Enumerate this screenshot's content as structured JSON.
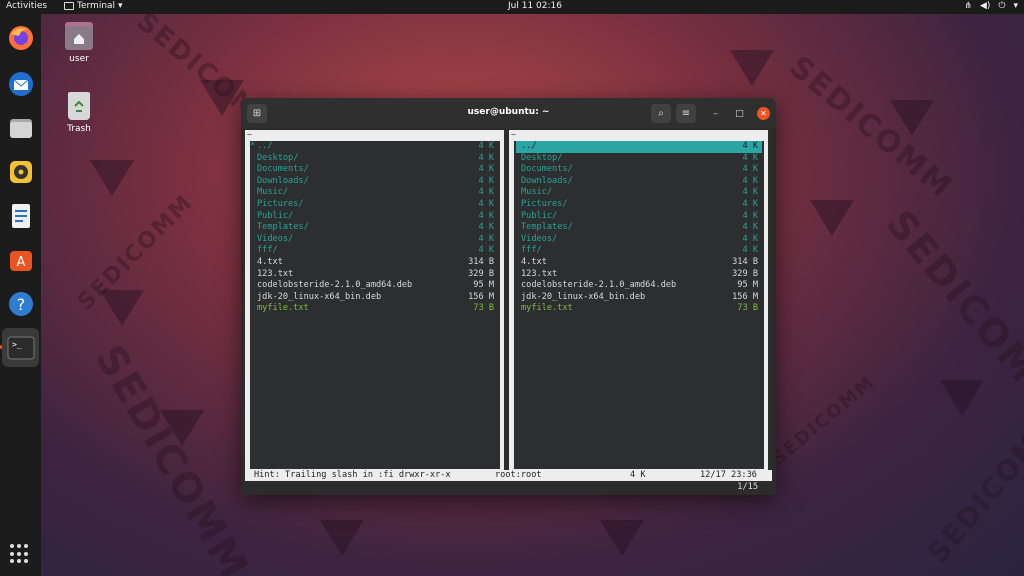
{
  "topbar": {
    "activities": "Activities",
    "app_name": "Terminal",
    "clock": "Jul 11  02:16"
  },
  "wallpaper": {
    "brand": "SEDICOMM"
  },
  "desktop": {
    "icons": [
      {
        "label": "user",
        "icon": "home-folder-icon"
      },
      {
        "label": "Trash",
        "icon": "trash-icon"
      }
    ]
  },
  "dock": {
    "items": [
      "firefox-icon",
      "thunderbird-icon",
      "files-icon",
      "rhythmbox-icon",
      "writer-icon",
      "software-icon",
      "help-icon",
      "terminal-icon"
    ],
    "show_apps": "show-applications-icon"
  },
  "window": {
    "title": "user@ubuntu: ~",
    "accent_close": "#e95420"
  },
  "left_panel": {
    "path": "~",
    "cursor_mark": "*",
    "entries": [
      {
        "name": "../",
        "size": "4 K",
        "kind": "dir"
      },
      {
        "name": "Desktop/",
        "size": "4 K",
        "kind": "dir"
      },
      {
        "name": "Documents/",
        "size": "4 K",
        "kind": "dir"
      },
      {
        "name": "Downloads/",
        "size": "4 K",
        "kind": "dir"
      },
      {
        "name": "Music/",
        "size": "4 K",
        "kind": "dir"
      },
      {
        "name": "Pictures/",
        "size": "4 K",
        "kind": "dir"
      },
      {
        "name": "Public/",
        "size": "4 K",
        "kind": "dir"
      },
      {
        "name": "Templates/",
        "size": "4 K",
        "kind": "dir"
      },
      {
        "name": "Videos/",
        "size": "4 K",
        "kind": "dir"
      },
      {
        "name": "fff/",
        "size": "4 K",
        "kind": "dir"
      },
      {
        "name": "4.txt",
        "size": "314 B",
        "kind": "file"
      },
      {
        "name": "123.txt",
        "size": "329 B",
        "kind": "file"
      },
      {
        "name": "codelobsteride-2.1.0_amd64.deb",
        "size": "95 M",
        "kind": "file"
      },
      {
        "name": "jdk-20_linux-x64_bin.deb",
        "size": "156 M",
        "kind": "file"
      },
      {
        "name": "myfile.txt",
        "size": "73 B",
        "kind": "exe"
      }
    ]
  },
  "right_panel": {
    "path": "~",
    "entries": [
      {
        "name": "../",
        "size": "4 K",
        "kind": "sel"
      },
      {
        "name": "Desktop/",
        "size": "4 K",
        "kind": "dir"
      },
      {
        "name": "Documents/",
        "size": "4 K",
        "kind": "dir"
      },
      {
        "name": "Downloads/",
        "size": "4 K",
        "kind": "dir"
      },
      {
        "name": "Music/",
        "size": "4 K",
        "kind": "dir"
      },
      {
        "name": "Pictures/",
        "size": "4 K",
        "kind": "dir"
      },
      {
        "name": "Public/",
        "size": "4 K",
        "kind": "dir"
      },
      {
        "name": "Templates/",
        "size": "4 K",
        "kind": "dir"
      },
      {
        "name": "Videos/",
        "size": "4 K",
        "kind": "dir"
      },
      {
        "name": "fff/",
        "size": "4 K",
        "kind": "dir"
      },
      {
        "name": "4.txt",
        "size": "314 B",
        "kind": "file"
      },
      {
        "name": "123.txt",
        "size": "329 B",
        "kind": "file"
      },
      {
        "name": "codelobsteride-2.1.0_amd64.deb",
        "size": "95 M",
        "kind": "file"
      },
      {
        "name": "jdk-20_linux-x64_bin.deb",
        "size": "156 M",
        "kind": "file"
      },
      {
        "name": "myfile.txt",
        "size": "73 B",
        "kind": "exe"
      }
    ]
  },
  "status": {
    "hint": "Hint: Trailing slash in :fi drwxr-xr-x",
    "owner": "root:root",
    "size": "4 K",
    "date": "12/17 23:36",
    "position": "1/15"
  }
}
